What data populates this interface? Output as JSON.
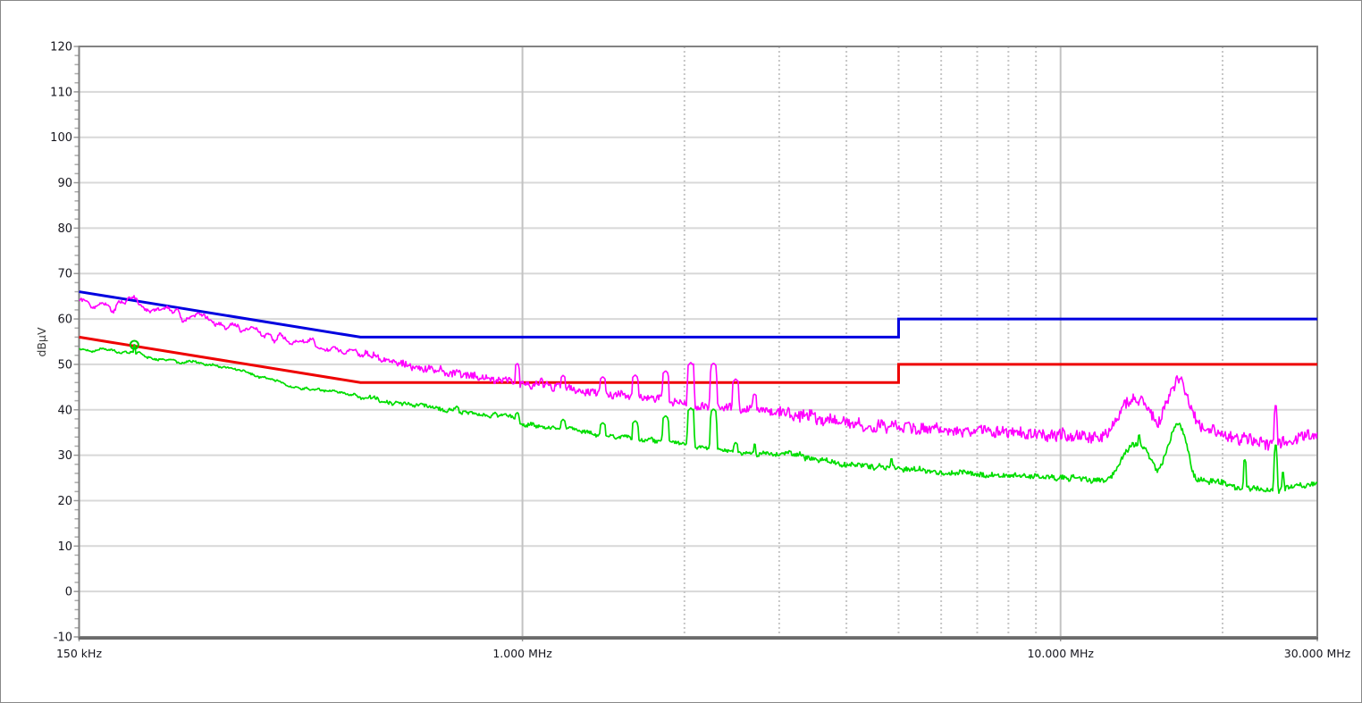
{
  "window": {
    "background": "#ffffff",
    "frame_border_color": "#888888"
  },
  "chart_data": {
    "type": "line",
    "title": "",
    "ylabel": "dBµV",
    "xlabel": "",
    "legend": "none",
    "x_axis": {
      "scale": "log",
      "min_khz": 150,
      "max_khz": 30000,
      "tick_labels": [
        {
          "khz": 150,
          "label": "150 kHz"
        },
        {
          "khz": 1000,
          "label": "1.000 MHz"
        },
        {
          "khz": 10000,
          "label": "10.000 MHz"
        },
        {
          "khz": 30000,
          "label": "30.000 MHz"
        }
      ],
      "solid_gridlines_khz": [
        1000,
        10000
      ],
      "dotted_gridlines_khz": [
        2000,
        3000,
        4000,
        5000,
        6000,
        7000,
        8000,
        9000,
        20000
      ]
    },
    "y_axis": {
      "label": "dBµV",
      "min": -10,
      "max": 120,
      "major_step": 10,
      "minor_step": 2,
      "major_ticks": [
        120,
        110,
        100,
        90,
        80,
        70,
        60,
        50,
        40,
        30,
        20,
        10,
        0,
        -10
      ]
    },
    "style": {
      "h_grid_color": "#d8d8d8",
      "v_grid_color": "#c2c2c2",
      "v_grid_dotted_color": "#c6c6c6",
      "frame_color": "#828282",
      "frame_bottom_color": "#6b6b6b",
      "tick_color": "#aaaaaa",
      "tick_label_color": "#16161e",
      "axis_title_color": "#3a3a3a"
    },
    "limit_lines": [
      {
        "name": "quasi-peak-limit",
        "color": "#0000e0",
        "width": 3,
        "points_khz_db": [
          [
            150,
            66
          ],
          [
            500,
            56
          ],
          [
            5000,
            56
          ],
          [
            5000,
            60
          ],
          [
            30000,
            60
          ]
        ]
      },
      {
        "name": "average-limit",
        "color": "#ee0000",
        "width": 3,
        "points_khz_db": [
          [
            150,
            56
          ],
          [
            500,
            46
          ],
          [
            5000,
            46
          ],
          [
            5000,
            50
          ],
          [
            30000,
            50
          ]
        ]
      }
    ],
    "series": [
      {
        "name": "peak-trace",
        "color": "#ff00ff",
        "width": 1.6,
        "seed": 1,
        "noise": {
          "lf_amp": [
            [
              500,
              1.1
            ],
            [
              31000,
              0.55
            ]
          ],
          "hf_amp": [
            [
              500,
              0.35
            ],
            [
              3000,
              0.75
            ],
            [
              31000,
              1.25
            ]
          ]
        },
        "anchors_khz_db": [
          [
            150,
            64.5
          ],
          [
            158,
            62.8
          ],
          [
            165,
            63.8
          ],
          [
            172,
            62.3
          ],
          [
            180,
            63.3
          ],
          [
            190,
            63.8
          ],
          [
            200,
            61.2
          ],
          [
            210,
            62.0
          ],
          [
            222,
            62.6
          ],
          [
            235,
            60.2
          ],
          [
            250,
            60.6
          ],
          [
            265,
            59.2
          ],
          [
            280,
            58.4
          ],
          [
            300,
            57.3
          ],
          [
            320,
            57.8
          ],
          [
            340,
            55.9
          ],
          [
            360,
            55.6
          ],
          [
            385,
            54.6
          ],
          [
            410,
            54.8
          ],
          [
            440,
            53.2
          ],
          [
            470,
            52.6
          ],
          [
            500,
            52.4
          ],
          [
            540,
            51.2
          ],
          [
            580,
            50.3
          ],
          [
            620,
            49.7
          ],
          [
            660,
            49.2
          ],
          [
            700,
            48.6
          ],
          [
            750,
            48.1
          ],
          [
            800,
            47.6
          ],
          [
            850,
            47.1
          ],
          [
            900,
            46.8
          ],
          [
            950,
            46.6
          ],
          [
            1000,
            45.9
          ],
          [
            1060,
            45.4
          ],
          [
            1120,
            45.2
          ],
          [
            1200,
            45.0
          ],
          [
            1300,
            43.9
          ],
          [
            1400,
            43.6
          ],
          [
            1500,
            43.3
          ],
          [
            1600,
            42.9
          ],
          [
            1700,
            42.6
          ],
          [
            1800,
            42.2
          ],
          [
            1900,
            41.9
          ],
          [
            2000,
            41.6
          ],
          [
            2150,
            41.0
          ],
          [
            2300,
            40.6
          ],
          [
            2500,
            40.2
          ],
          [
            2700,
            40.0
          ],
          [
            2900,
            39.8
          ],
          [
            3100,
            39.3
          ],
          [
            3400,
            38.5
          ],
          [
            3700,
            37.8
          ],
          [
            4000,
            37.2
          ],
          [
            4400,
            36.7
          ],
          [
            4800,
            36.2
          ],
          [
            5200,
            36.0
          ],
          [
            5700,
            35.7
          ],
          [
            6300,
            35.4
          ],
          [
            7000,
            35.2
          ],
          [
            8000,
            35.0
          ],
          [
            9000,
            34.8
          ],
          [
            10000,
            34.6
          ],
          [
            11000,
            34.3
          ],
          [
            11800,
            34.2
          ],
          [
            12300,
            35.0
          ],
          [
            12700,
            37.5
          ],
          [
            13100,
            40.5
          ],
          [
            13500,
            42.2
          ],
          [
            13900,
            42.6
          ],
          [
            14300,
            41.8
          ],
          [
            14700,
            39.5
          ],
          [
            15100,
            36.8
          ],
          [
            15400,
            38.0
          ],
          [
            15800,
            42.0
          ],
          [
            16200,
            45.5
          ],
          [
            16500,
            47.0
          ],
          [
            16800,
            45.8
          ],
          [
            17200,
            42.5
          ],
          [
            17600,
            39.0
          ],
          [
            18000,
            36.8
          ],
          [
            18500,
            35.8
          ],
          [
            19000,
            35.3
          ],
          [
            20000,
            34.8
          ],
          [
            21000,
            34.2
          ],
          [
            22000,
            33.6
          ],
          [
            23000,
            33.0
          ],
          [
            24000,
            32.7
          ],
          [
            25000,
            32.6
          ],
          [
            26000,
            32.6
          ],
          [
            27000,
            33.0
          ],
          [
            28000,
            33.8
          ],
          [
            29000,
            34.3
          ],
          [
            30000,
            34.3
          ]
        ],
        "spikes_khz_db_w": [
          [
            978,
            50.2,
            2
          ],
          [
            1085,
            47.0,
            1
          ],
          [
            1190,
            47.6,
            2
          ],
          [
            1410,
            47.3,
            3
          ],
          [
            1620,
            47.7,
            3
          ],
          [
            1845,
            48.6,
            3
          ],
          [
            2055,
            50.4,
            3
          ],
          [
            2265,
            50.3,
            3
          ],
          [
            2490,
            46.8,
            3
          ],
          [
            2700,
            43.5,
            2
          ],
          [
            25100,
            41.0,
            1
          ]
        ]
      },
      {
        "name": "average-trace",
        "color": "#00dd00",
        "width": 1.7,
        "seed": 2,
        "noise": {
          "lf_amp": [
            [
              31000,
              0.4
            ]
          ],
          "hf_amp": [
            [
              500,
              0.2
            ],
            [
              3000,
              0.4
            ],
            [
              31000,
              0.55
            ]
          ]
        },
        "anchors_khz_db": [
          [
            150,
            53.4
          ],
          [
            160,
            53.0
          ],
          [
            170,
            53.3
          ],
          [
            180,
            52.6
          ],
          [
            188,
            53.0
          ],
          [
            196,
            52.2
          ],
          [
            205,
            51.2
          ],
          [
            215,
            50.9
          ],
          [
            228,
            50.7
          ],
          [
            242,
            50.4
          ],
          [
            258,
            50.0
          ],
          [
            275,
            49.6
          ],
          [
            295,
            48.9
          ],
          [
            315,
            47.9
          ],
          [
            340,
            46.6
          ],
          [
            365,
            45.6
          ],
          [
            395,
            44.7
          ],
          [
            425,
            44.2
          ],
          [
            455,
            43.8
          ],
          [
            485,
            43.2
          ],
          [
            520,
            42.6
          ],
          [
            560,
            41.8
          ],
          [
            600,
            41.4
          ],
          [
            640,
            41.1
          ],
          [
            680,
            40.6
          ],
          [
            720,
            40.2
          ],
          [
            770,
            39.7
          ],
          [
            820,
            39.2
          ],
          [
            870,
            38.8
          ],
          [
            920,
            38.6
          ],
          [
            970,
            38.2
          ],
          [
            1000,
            36.9
          ],
          [
            1060,
            36.4
          ],
          [
            1130,
            36.2
          ],
          [
            1200,
            36.0
          ],
          [
            1280,
            35.1
          ],
          [
            1360,
            34.5
          ],
          [
            1450,
            34.2
          ],
          [
            1550,
            33.9
          ],
          [
            1650,
            33.6
          ],
          [
            1760,
            33.3
          ],
          [
            1880,
            33.0
          ],
          [
            2000,
            32.4
          ],
          [
            2150,
            31.6
          ],
          [
            2300,
            31.0
          ],
          [
            2450,
            30.5
          ],
          [
            2600,
            30.2
          ],
          [
            2750,
            30.1
          ],
          [
            2900,
            30.4
          ],
          [
            3050,
            30.6
          ],
          [
            3200,
            30.2
          ],
          [
            3400,
            29.4
          ],
          [
            3600,
            28.9
          ],
          [
            3800,
            28.4
          ],
          [
            4000,
            28.1
          ],
          [
            4300,
            27.6
          ],
          [
            4600,
            27.3
          ],
          [
            5000,
            27.0
          ],
          [
            5500,
            26.6
          ],
          [
            6000,
            26.3
          ],
          [
            6500,
            26.1
          ],
          [
            7000,
            25.9
          ],
          [
            7600,
            25.6
          ],
          [
            8200,
            25.4
          ],
          [
            9000,
            25.2
          ],
          [
            10000,
            25.2
          ],
          [
            10800,
            24.9
          ],
          [
            11500,
            24.6
          ],
          [
            12000,
            24.4
          ],
          [
            12400,
            24.8
          ],
          [
            12800,
            27.0
          ],
          [
            13200,
            30.8
          ],
          [
            13600,
            32.3
          ],
          [
            14000,
            32.4
          ],
          [
            14400,
            31.8
          ],
          [
            14800,
            28.5
          ],
          [
            15100,
            26.2
          ],
          [
            15400,
            27.5
          ],
          [
            15800,
            31.5
          ],
          [
            16200,
            35.5
          ],
          [
            16500,
            37.3
          ],
          [
            16800,
            36.0
          ],
          [
            17200,
            31.5
          ],
          [
            17600,
            26.0
          ],
          [
            18000,
            24.6
          ],
          [
            18500,
            24.4
          ],
          [
            19000,
            24.2
          ],
          [
            20000,
            23.9
          ],
          [
            21000,
            23.3
          ],
          [
            22000,
            22.9
          ],
          [
            23000,
            22.7
          ],
          [
            24000,
            22.6
          ],
          [
            25000,
            22.5
          ],
          [
            26000,
            22.6
          ],
          [
            27000,
            23.0
          ],
          [
            28000,
            23.2
          ],
          [
            29000,
            23.3
          ],
          [
            30000,
            23.7
          ]
        ],
        "spikes_khz_db_w": [
          [
            190,
            54.4,
            1
          ],
          [
            755,
            40.8,
            2
          ],
          [
            978,
            39.4,
            2
          ],
          [
            1190,
            37.9,
            2
          ],
          [
            1410,
            37.2,
            3
          ],
          [
            1620,
            37.6,
            3
          ],
          [
            1845,
            38.7,
            3
          ],
          [
            2055,
            40.4,
            3
          ],
          [
            2265,
            40.2,
            3
          ],
          [
            2490,
            32.8,
            2
          ],
          [
            2700,
            32.5,
            1
          ],
          [
            4850,
            29.3,
            1
          ],
          [
            14000,
            34.5,
            1
          ],
          [
            22000,
            29.0,
            1
          ],
          [
            25100,
            32.3,
            1
          ],
          [
            25900,
            26.3,
            1
          ]
        ]
      }
    ],
    "marker": {
      "name": "peak-marker",
      "f_khz": 190,
      "level_db": 54.3,
      "color": "#00cc00"
    }
  }
}
